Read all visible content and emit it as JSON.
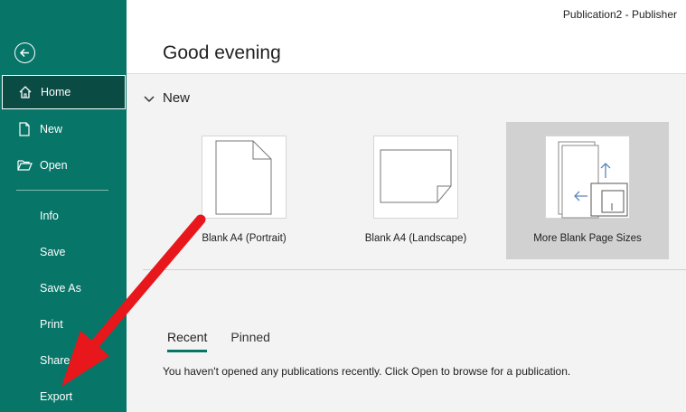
{
  "window": {
    "title": "Publication2  -  Publisher"
  },
  "header": {
    "greeting": "Good evening"
  },
  "sidebar": {
    "items": [
      {
        "label": "Home",
        "icon": "home-icon"
      },
      {
        "label": "New",
        "icon": "new-document-icon"
      },
      {
        "label": "Open",
        "icon": "folder-open-icon"
      },
      {
        "label": "Info"
      },
      {
        "label": "Save"
      },
      {
        "label": "Save As"
      },
      {
        "label": "Print"
      },
      {
        "label": "Share"
      },
      {
        "label": "Export"
      }
    ]
  },
  "new_section": {
    "title": "New",
    "templates": [
      {
        "label": "Blank A4 (Portrait)"
      },
      {
        "label": "Blank A4 (Landscape)"
      },
      {
        "label": "More Blank Page Sizes"
      }
    ]
  },
  "files": {
    "tabs": [
      "Recent",
      "Pinned"
    ],
    "empty_message": "You haven't opened any publications recently. Click Open to browse for a publication."
  },
  "colors": {
    "accent": "#077568",
    "active_nav": "#0a4b44",
    "annotation_arrow": "#e8171b"
  }
}
